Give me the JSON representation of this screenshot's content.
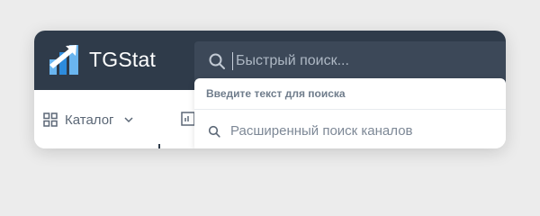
{
  "header": {
    "brand": "TGStat",
    "logo_icon": "tgstat-logo-icon",
    "colors": {
      "background": "#2f3b4a",
      "logo_light": "#6ab5ef",
      "logo_dark": "#2d8bdc"
    }
  },
  "search": {
    "icon": "search-icon",
    "placeholder": "Быстрый поиск...",
    "value": ""
  },
  "nav": {
    "catalog_label": "Каталог",
    "catalog_icon": "grid-icon",
    "chevron_icon": "chevron-down-icon",
    "stats_icon": "bar-chart-icon"
  },
  "dropdown": {
    "hint": "Введите текст для поиска",
    "advanced_search_label": "Расширенный поиск каналов",
    "advanced_search_icon": "search-icon"
  }
}
